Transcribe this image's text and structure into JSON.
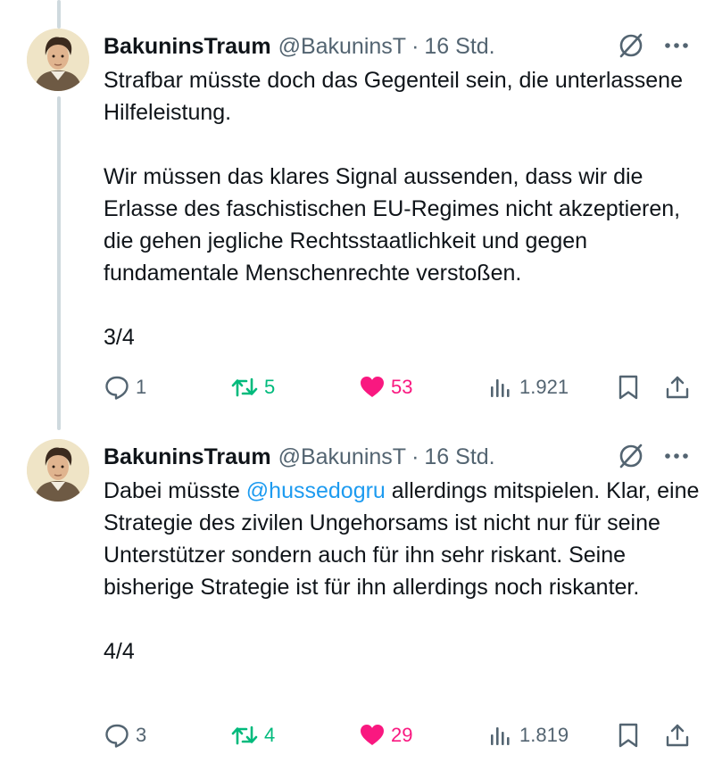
{
  "tweets": [
    {
      "display_name": "BakuninsTraum",
      "handle": "@BakuninsT",
      "separator": "·",
      "time": "16 Std.",
      "paragraphs": [
        "Strafbar müsste doch das Gegenteil sein, die unterlassene Hilfeleistung.",
        "Wir müssen das klares Signal aussenden, dass wir die Erlasse des faschistischen EU-Regimes nicht akzeptieren, die gehen jegliche Rechtsstaatlichkeit und gegen fundamentale Menschenrechte verstoßen.",
        "3/4"
      ],
      "stats": {
        "replies": "1",
        "reposts": "5",
        "likes": "53",
        "views": "1.921"
      }
    },
    {
      "display_name": "BakuninsTraum",
      "handle": "@BakuninsT",
      "separator": "·",
      "time": "16 Std.",
      "text_before_mention": "Dabei müsste ",
      "mention": "@hussedogru",
      "text_after_mention": " allerdings mitspielen. Klar, eine Strategie des zivilen Ungehorsams ist nicht nur für seine Unterstützer sondern auch für ihn sehr riskant. Seine bisherige Strategie ist für ihn allerdings noch riskanter.",
      "footer": "4/4",
      "stats": {
        "replies": "3",
        "reposts": "4",
        "likes": "29",
        "views": "1.819"
      }
    }
  ],
  "colors": {
    "text": "#0f1419",
    "secondary": "#536471",
    "link": "#1d9bf0",
    "repost": "#00ba7c",
    "like": "#f91880",
    "thread_line": "#cfd9de"
  },
  "icons": [
    "reply-icon",
    "repost-icon",
    "like-icon",
    "views-icon",
    "bookmark-icon",
    "share-icon",
    "grok-icon",
    "more-icon"
  ]
}
